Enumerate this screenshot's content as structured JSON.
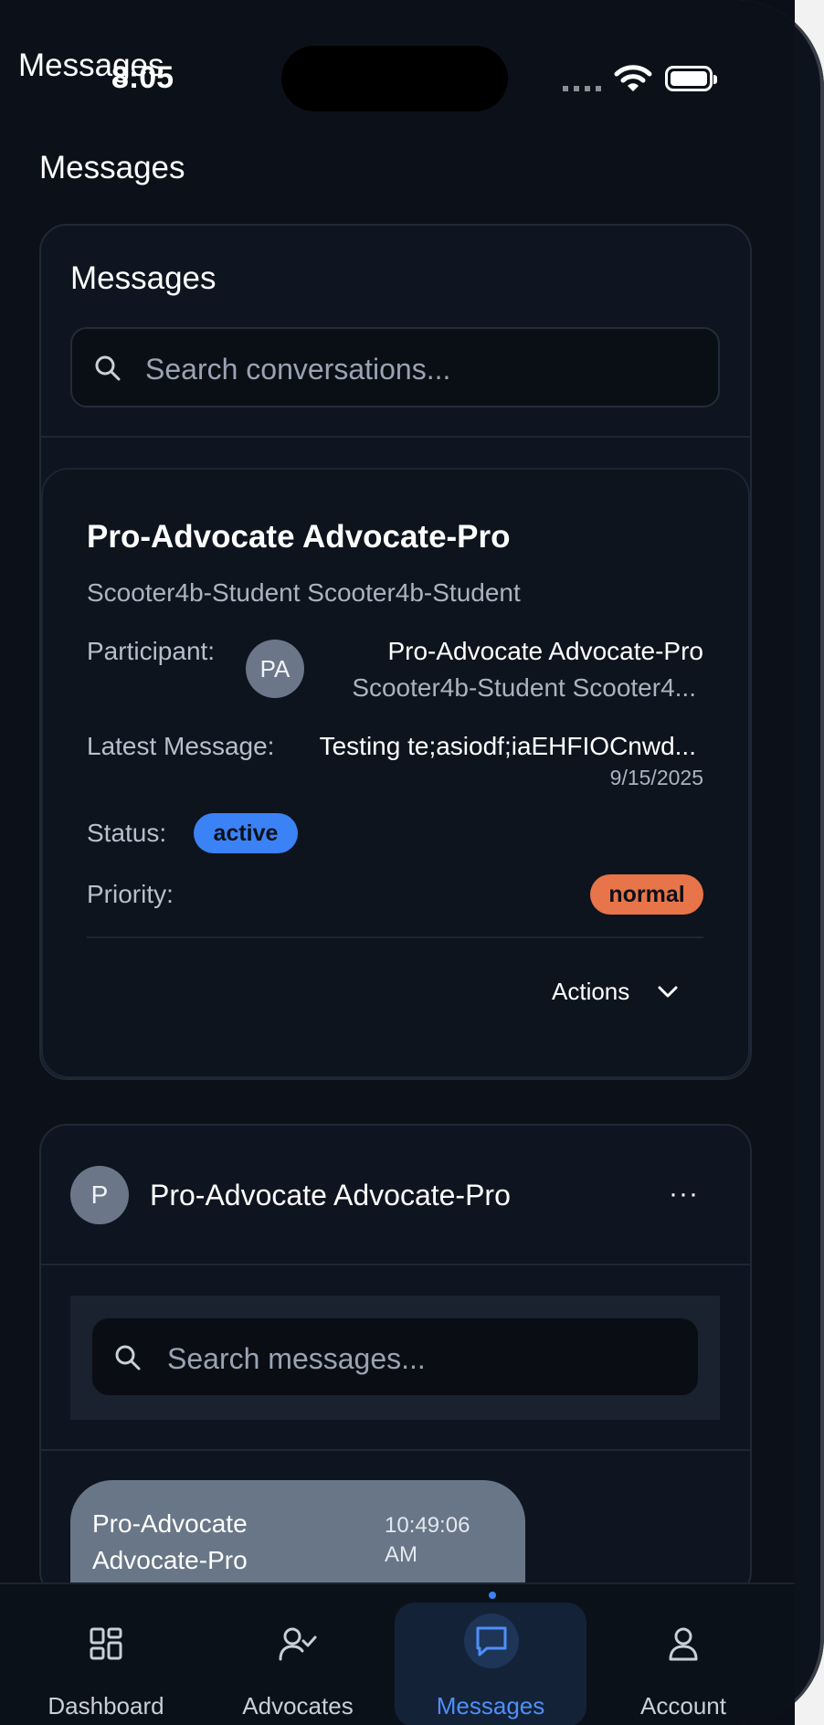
{
  "status_bar": {
    "time": "8:05",
    "browser_tab_title": "Messages"
  },
  "page": {
    "title": "Messages"
  },
  "conversations_panel": {
    "title": "Messages",
    "search_placeholder": "Search conversations..."
  },
  "conversation": {
    "name": "Pro-Advocate Advocate-Pro",
    "subtitle": "Scooter4b-Student Scooter4b-Student",
    "participant_label": "Participant:",
    "participant_initials": "PA",
    "participant_name": "Pro-Advocate Advocate-Pro",
    "participant_secondary": "Scooter4b-Student Scooter4...",
    "latest_message_label": "Latest Message:",
    "latest_message": "Testing te;asiodf;iaEHFIOCnwd...",
    "latest_message_date": "9/15/2025",
    "status_label": "Status:",
    "status": "active",
    "priority_label": "Priority:",
    "priority": "normal",
    "actions_label": "Actions"
  },
  "chat": {
    "avatar_initial": "P",
    "name": "Pro-Advocate Advocate-Pro",
    "more_label": "···",
    "search_placeholder": "Search messages...",
    "messages": [
      {
        "sender": "Pro-Advocate Advocate-Pro",
        "time": "10:49:06 AM"
      }
    ]
  },
  "tabbar": {
    "tabs": [
      {
        "label": "Dashboard",
        "icon": "grid-icon"
      },
      {
        "label": "Advocates",
        "icon": "user-check-icon"
      },
      {
        "label": "Messages",
        "icon": "chat-bubble-icon",
        "active": true
      },
      {
        "label": "Account",
        "icon": "user-icon"
      }
    ]
  },
  "colors": {
    "background": "#0c1119",
    "card": "#0e1520",
    "accent_blue": "#3b82f6",
    "status_active": "#3b82f6",
    "priority_normal": "#e8744a"
  }
}
